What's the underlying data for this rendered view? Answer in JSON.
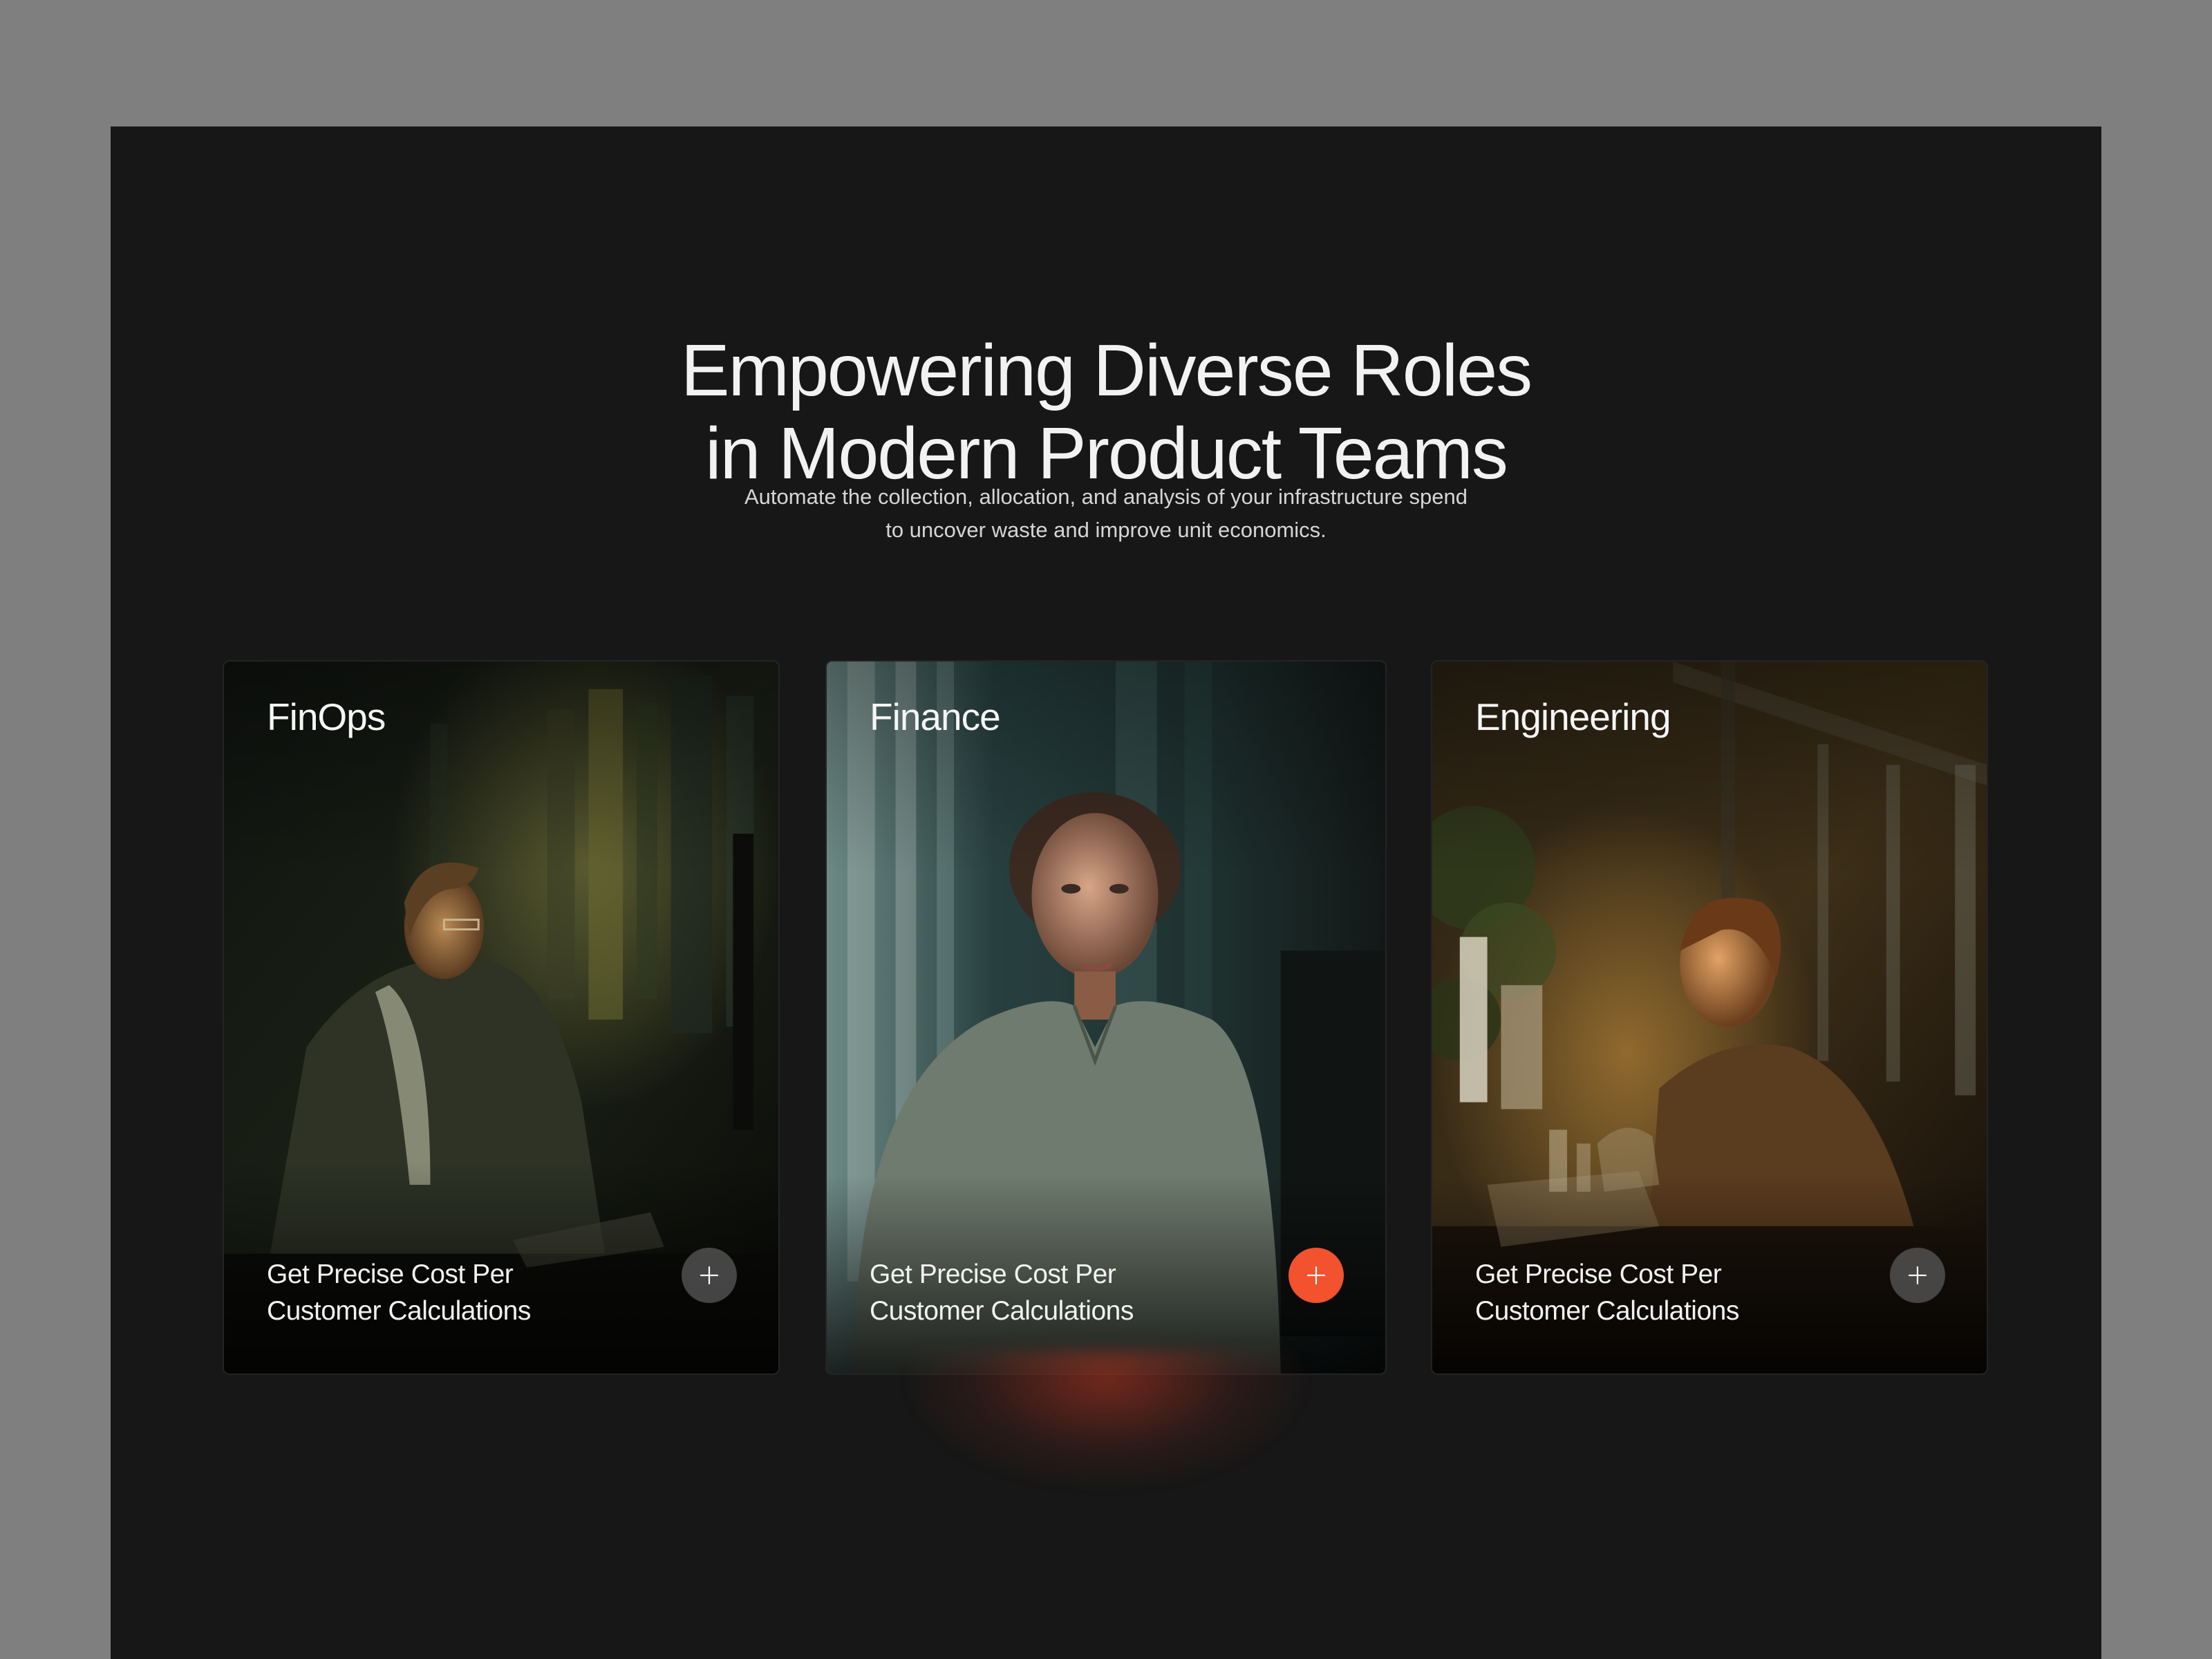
{
  "hero": {
    "title_line1": "Empowering Diverse Roles",
    "title_line2": "in Modern Product Teams",
    "subtitle_line1": "Automate the collection, allocation, and analysis of your infrastructure spend",
    "subtitle_line2": "to uncover waste and improve unit economics."
  },
  "cards": [
    {
      "title": "FinOps",
      "caption_line1": "Get Precise Cost Per",
      "caption_line2": "Customer Calculations",
      "button_icon": "plus-icon",
      "active": false
    },
    {
      "title": "Finance",
      "caption_line1": "Get Precise Cost Per",
      "caption_line2": "Customer Calculations",
      "button_icon": "plus-icon",
      "active": true
    },
    {
      "title": "Engineering",
      "caption_line1": "Get Precise Cost Per",
      "caption_line2": "Customer Calculations",
      "button_icon": "plus-icon",
      "active": false
    }
  ],
  "colors": {
    "page_background": "#171717",
    "accent": "#f2522e",
    "button_inactive": "#5a5a5a"
  }
}
